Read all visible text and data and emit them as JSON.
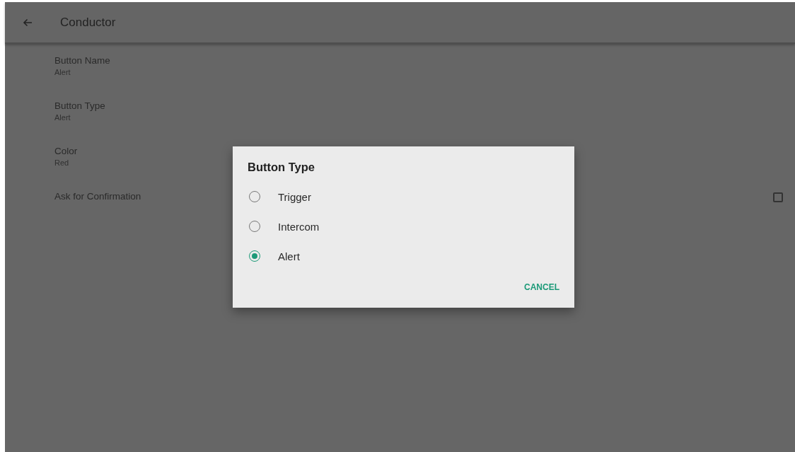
{
  "toolbar": {
    "title": "Conductor"
  },
  "settings": [
    {
      "kind": "text",
      "title": "Button Name",
      "value": "Alert"
    },
    {
      "kind": "text",
      "title": "Button Type",
      "value": "Alert"
    },
    {
      "kind": "text",
      "title": "Color",
      "value": "Red"
    },
    {
      "kind": "checkbox",
      "title": "Ask for Confirmation",
      "checked": false
    }
  ],
  "dialog": {
    "title": "Button Type",
    "options": [
      {
        "label": "Trigger",
        "selected": false
      },
      {
        "label": "Intercom",
        "selected": false
      },
      {
        "label": "Alert",
        "selected": true
      }
    ],
    "buttons": [
      "CANCEL"
    ]
  }
}
